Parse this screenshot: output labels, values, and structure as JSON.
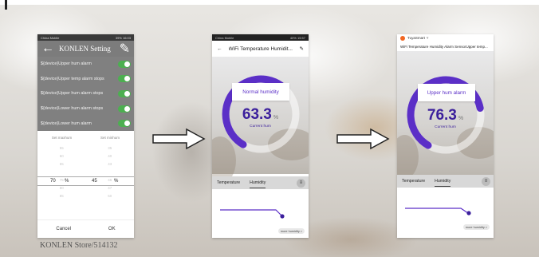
{
  "watermark": "KONLEN Store/514132",
  "screen1": {
    "status_left": "China Mobile",
    "status_right": "39% 16:03",
    "title": "KONLEN Setting",
    "settings": [
      {
        "label": "${device}Upper hum alarm",
        "on": true
      },
      {
        "label": "${device}Upper temp alarm stops",
        "on": true
      },
      {
        "label": "${device}Upper hum alarm stops",
        "on": true
      },
      {
        "label": "${device}Lower hum alarm stops",
        "on": true
      },
      {
        "label": "${device}Lower hum alarm",
        "on": true
      }
    ],
    "picker": {
      "left_header": "Set maxhum",
      "right_header": "Set minhum",
      "left_values": [
        "55",
        "60",
        "65",
        "",
        "75",
        "80",
        "85"
      ],
      "right_values": [
        "35",
        "40",
        "43",
        "",
        "46",
        "47",
        "50"
      ],
      "left_selected": "70",
      "right_selected": "45",
      "unit": "%"
    },
    "cancel_label": "Cancel",
    "ok_label": "OK"
  },
  "screen2": {
    "status_left": "China Mobile",
    "status_right": "40% 15:57",
    "title": "WiFi Temperature Humidit...",
    "gauge_label": "Normal humidity",
    "value": "63.3",
    "unit": "%",
    "gauge_fraction": 0.633,
    "sublabel": "Current hum",
    "tab_temperature": "Temperature",
    "tab_humidity": "Humidity",
    "more_label": "more humidity >"
  },
  "screen3": {
    "brand": "TuyaSmart",
    "title": "WiFi Temperature Humidity Alarm SensorUpper temp...",
    "gauge_label": "Upper hum alarm",
    "value": "76.3",
    "unit": "%",
    "gauge_fraction": 0.763,
    "sublabel": "Current hum",
    "tab_temperature": "Temperature",
    "tab_humidity": "Humidity",
    "more_label": "more humidity >"
  },
  "colors": {
    "accent": "#5b2fc7",
    "toggle_on": "#4caf50"
  }
}
